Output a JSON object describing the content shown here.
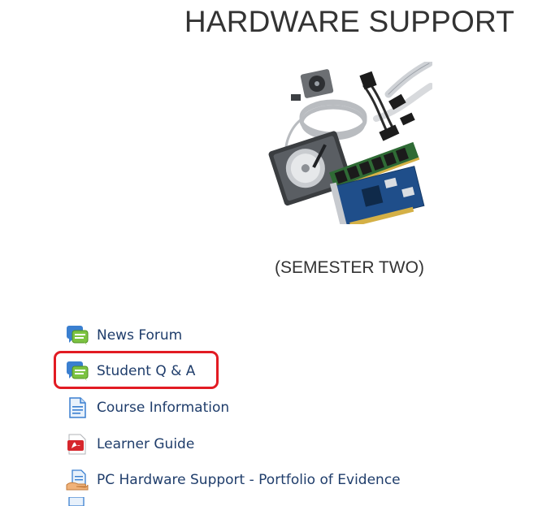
{
  "course": {
    "title": "HARDWARE SUPPORT",
    "subtitle": "(SEMESTER TWO)",
    "image_name": "hardware-components-image"
  },
  "activities": [
    {
      "label": "News Forum",
      "icon": "forum-icon"
    },
    {
      "label": "Student Q & A",
      "icon": "forum-icon",
      "highlighted": true
    },
    {
      "label": "Course Information",
      "icon": "document-page-icon"
    },
    {
      "label": "Learner Guide",
      "icon": "pdf-icon"
    },
    {
      "label": "PC Hardware Support - Portfolio of Evidence",
      "icon": "assignment-upload-icon"
    }
  ],
  "colors": {
    "link": "#1f3d6b",
    "highlight": "#e21b23",
    "forum_green": "#7cc341",
    "forum_blue": "#3a7fd0"
  }
}
